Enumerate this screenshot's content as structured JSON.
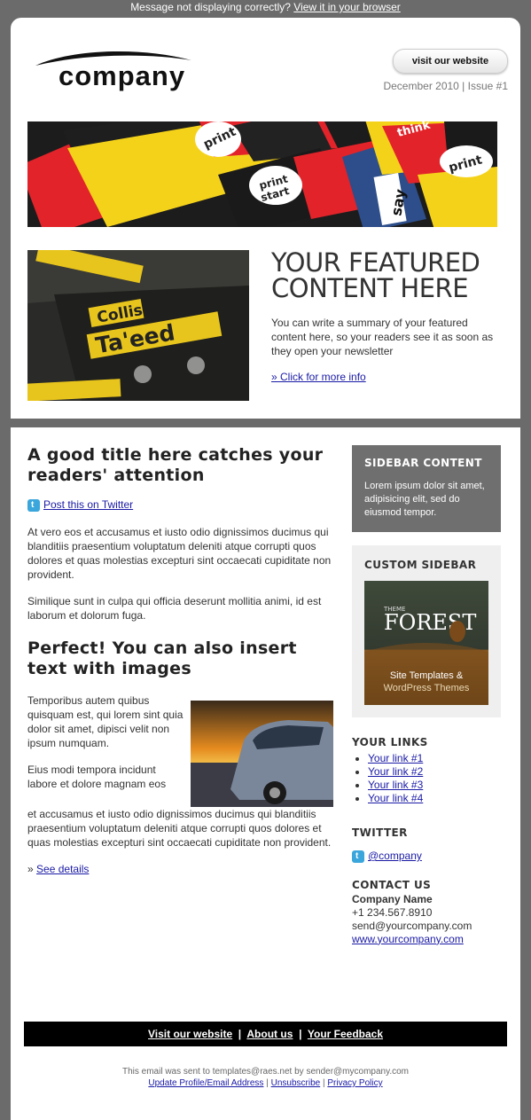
{
  "topbar": {
    "message": "Message not displaying correctly?",
    "link": "View it in your browser"
  },
  "header": {
    "logo_text": "company",
    "visit_button": "visit our website",
    "issue": "December 2010 | Issue #1"
  },
  "featured": {
    "title": "YOUR FEATURED CONTENT HERE",
    "summary": "You can write a summary of your featured content here, so your readers see it as soon as they open your newsletter",
    "link": "» Click for more info",
    "card_brand_line1": "Collis",
    "card_brand_line2": "Ta'eed"
  },
  "banner_words": [
    "print",
    "start",
    "think",
    "print",
    "say"
  ],
  "article": {
    "title": "A good title here catches your readers' attention",
    "twitter_link": "Post this on Twitter",
    "para1": "At vero eos et accusamus et iusto odio dignissimos ducimus qui blanditiis praesentium voluptatum deleniti atque corrupti quos dolores et quas molestias excepturi sint occaecati cupiditate non provident.",
    "para2": "Similique sunt in culpa qui officia deserunt mollitia animi, id est laborum et dolorum fuga.",
    "title2": "Perfect! You can also insert text with images",
    "img_para1": "Temporibus autem quibus quisquam est, qui lorem sint quia dolor sit amet, dipisci velit non ipsum numquam.",
    "img_para2_top": "Eius modi tempora incidunt labore et dolore magnam eos",
    "img_para2_rest": "et accusamus et iusto odio dignissimos ducimus qui blanditiis praesentium voluptatum deleniti atque corrupti quos dolores et quas molestias excepturi sint occaecati cupiditate non provident.",
    "see_details_prefix": "»",
    "see_details": "See details"
  },
  "sidebar": {
    "content_title": "SIDEBAR CONTENT",
    "content_text": "Lorem ipsum dolor sit amet, adipisicing elit, sed do eiusmod tempor.",
    "custom_title": "CUSTOM SIDEBAR",
    "ad_brand_small": "THEME",
    "ad_brand": "FOREST",
    "ad_tagline1": "Site Templates &",
    "ad_tagline2": "WordPress Themes",
    "links_title": "YOUR LINKS",
    "links": [
      "Your link #1",
      "Your link #2",
      "Your link #3",
      "Your link #4"
    ],
    "twitter_title": "TWITTER",
    "twitter_handle": "@company",
    "contact_title": "CONTACT US",
    "company_name": "Company Name",
    "phone": "+1 234.567.8910",
    "email": "send@yourcompany.com",
    "website": "www.yourcompany.com"
  },
  "footer": {
    "nav": [
      "Visit our website",
      "About us",
      "Your Feedback"
    ],
    "separator": "|",
    "note": "This email was sent to templates@raes.net by sender@mycompany.com",
    "links": [
      "Update Profile/Email Address",
      "Unsubscribe",
      "Privacy Policy"
    ]
  },
  "colors": {
    "background": "#6b6b6b",
    "link": "#1a1aa6",
    "sidebar_grey": "#6f6f6f",
    "banner_yellow": "#f5d21a",
    "banner_red": "#e2232a"
  }
}
